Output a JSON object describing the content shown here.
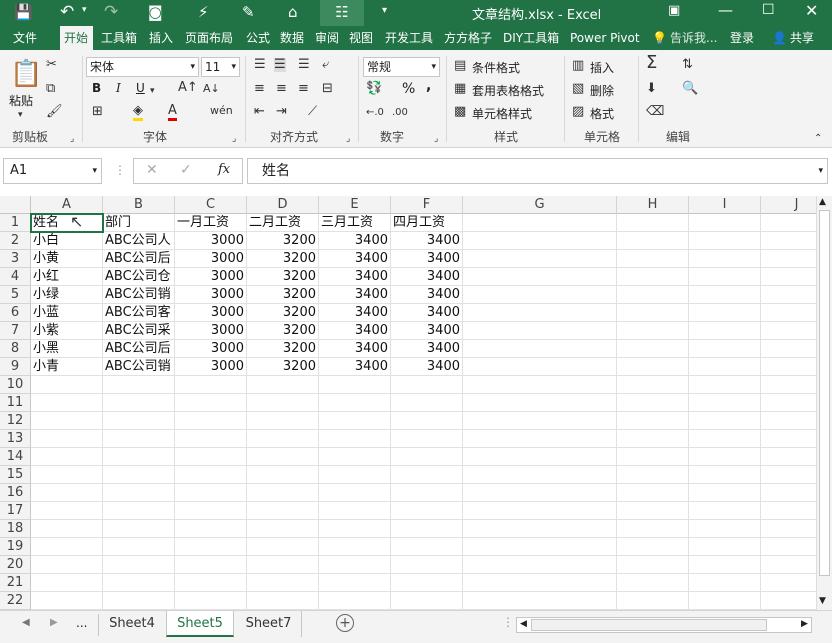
{
  "window": {
    "title": "文章结构.xlsx - Excel"
  },
  "ribbon_tabs": [
    "文件",
    "开始",
    "工具箱",
    "插入",
    "页面布局",
    "公式",
    "数据",
    "审阅",
    "视图",
    "开发工具",
    "方方格子",
    "DIY工具箱",
    "Power Pivot"
  ],
  "tellme": "告诉我...",
  "login": "登录",
  "share": "共享",
  "ribbon": {
    "paste": "粘贴",
    "font_name": "宋体",
    "font_size": "11",
    "number_format": "常规",
    "conditional_format": "条件格式",
    "table_format": "套用表格格式",
    "cell_style": "单元格样式",
    "insert": "插入",
    "delete": "删除",
    "format": "格式",
    "bold": "B",
    "italic": "I",
    "underline": "U",
    "percent": "%",
    "comma": ",",
    "groups": [
      "剪贴板",
      "字体",
      "对齐方式",
      "数字",
      "样式",
      "单元格",
      "编辑"
    ]
  },
  "formula_bar": {
    "name_box": "A1",
    "formula": "姓名",
    "fx": "fx"
  },
  "columns": [
    "A",
    "B",
    "C",
    "D",
    "E",
    "F",
    "G",
    "H",
    "I",
    "J"
  ],
  "rows": [
    "1",
    "2",
    "3",
    "4",
    "5",
    "6",
    "7",
    "8",
    "9",
    "10",
    "11",
    "12",
    "13",
    "14",
    "15",
    "16",
    "17",
    "18",
    "19",
    "20",
    "21",
    "22"
  ],
  "table": [
    [
      "姓名",
      "部门",
      "一月工资",
      "二月工资",
      "三月工资",
      "四月工资"
    ],
    [
      "小白",
      "ABC公司人",
      "3000",
      "3200",
      "3400",
      "3400"
    ],
    [
      "小黄",
      "ABC公司后",
      "3000",
      "3200",
      "3400",
      "3400"
    ],
    [
      "小红",
      "ABC公司仓",
      "3000",
      "3200",
      "3400",
      "3400"
    ],
    [
      "小绿",
      "ABC公司销",
      "3000",
      "3200",
      "3400",
      "3400"
    ],
    [
      "小蓝",
      "ABC公司客",
      "3000",
      "3200",
      "3400",
      "3400"
    ],
    [
      "小紫",
      "ABC公司采",
      "3000",
      "3200",
      "3400",
      "3400"
    ],
    [
      "小黑",
      "ABC公司后",
      "3000",
      "3200",
      "3400",
      "3400"
    ],
    [
      "小青",
      "ABC公司销",
      "3000",
      "3200",
      "3400",
      "3400"
    ]
  ],
  "sheets": [
    "Sheet4",
    "Sheet5",
    "Sheet7"
  ],
  "active_sheet": "Sheet5",
  "more_sheets": "...",
  "colors": {
    "accent": "#217346"
  }
}
